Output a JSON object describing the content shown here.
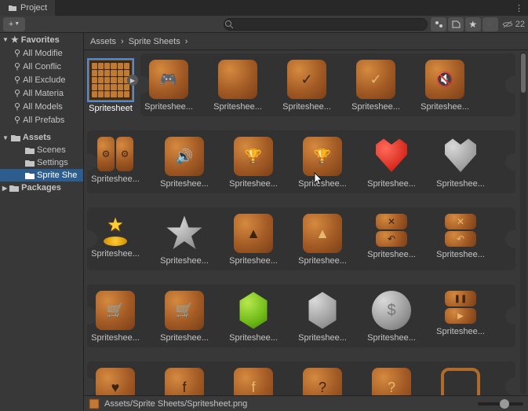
{
  "tab": {
    "label": "Project"
  },
  "toolbar": {
    "plus": "+",
    "search_placeholder": "",
    "hidden_count": "22"
  },
  "sidebar": {
    "favorites": {
      "label": "Favorites",
      "items": [
        "All Modifie",
        "All Conflic",
        "All Exclude",
        "All Materia",
        "All Models",
        "All Prefabs"
      ]
    },
    "assets": {
      "label": "Assets",
      "items": [
        "Scenes",
        "Settings",
        "Sprite She"
      ]
    },
    "packages": {
      "label": "Packages"
    }
  },
  "breadcrumb": [
    "Assets",
    "Sprite Sheets"
  ],
  "grid": {
    "first_label": "Spritesheet",
    "trunc_label": "Spriteshee..."
  },
  "footer": {
    "path": "Assets/Sprite Sheets/Spritesheet.png"
  }
}
